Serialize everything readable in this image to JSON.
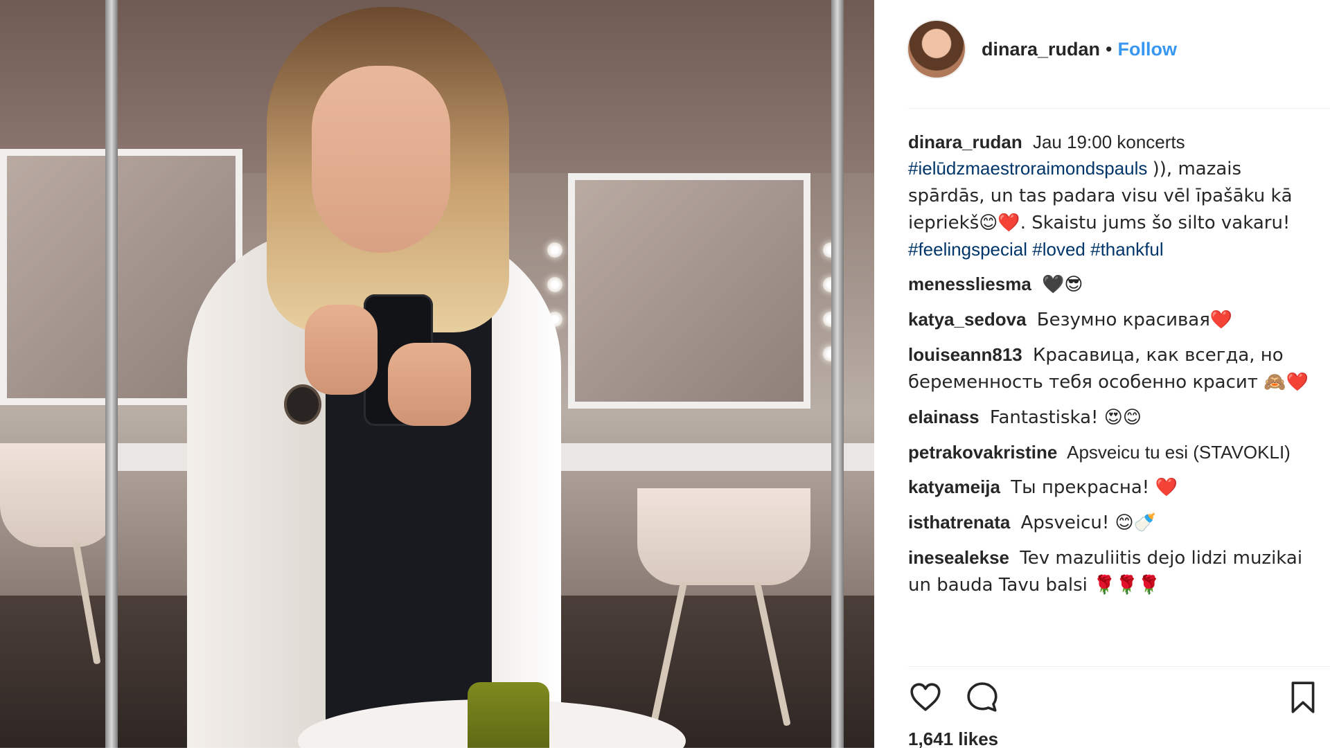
{
  "post": {
    "author": "dinara_rudan",
    "follow_label": "Follow",
    "separator": "•",
    "caption": {
      "user": "dinara_rudan",
      "text_1": "Jau 19:00 koncerts",
      "hashtag_1": "#ielūdzmaestroraimondspauls",
      "text_2": ")), mazais spārdās, un tas padara visu vēl īpašāku kā iepriekš😊❤️. Skaistu jums šo silto vakaru!",
      "hashtag_2": "#feelingspecial",
      "hashtag_3": "#loved",
      "hashtag_4": "#thankful"
    },
    "comments": [
      {
        "user": "menessliesma",
        "text": "🖤😎"
      },
      {
        "user": "katya_sedova",
        "text": "Безумно красивая❤️"
      },
      {
        "user": "louiseann813",
        "text": "Красавица, как всегда, но беременность тебя особенно красит 🙈❤️"
      },
      {
        "user": "elainass",
        "text": "Fantastiska! 😍😊"
      },
      {
        "user": "petrakovakristine",
        "text": "Apsveicu tu esi (STAVOKLI)"
      },
      {
        "user": "katyameija",
        "text": "Ты прекрасна! ❤️"
      },
      {
        "user": "isthatrenata",
        "text": "Apsveicu! 😊🍼"
      },
      {
        "user": "inesealekse",
        "text": "Tev mazuliitis dejo lidzi muzikai un bauda Tavu balsi 🌹🌹🌹"
      }
    ],
    "likes": "1,641 likes"
  },
  "icons": {
    "like": "heart-outline-icon",
    "comment": "comment-bubble-icon",
    "save": "bookmark-outline-icon"
  },
  "colors": {
    "link_blue": "#3897f0",
    "hashtag": "#003569",
    "text": "#262626",
    "divider": "#efefef"
  }
}
